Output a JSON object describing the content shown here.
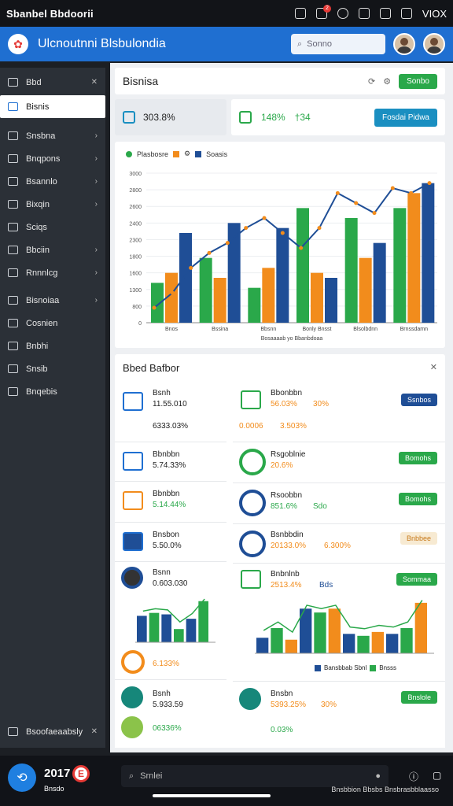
{
  "statusbar": {
    "title": "Sbanbel Bbdoorii",
    "right_text": "VIOX",
    "notification_count": "2"
  },
  "app": {
    "title": "Ulcnoutnni Blsbulondia",
    "search_placeholder": "Sonno"
  },
  "sidebar": {
    "items": [
      {
        "label": "Bbd",
        "icon": "dashboard-icon",
        "active": false,
        "chevron": false
      },
      {
        "label": "Bisnis",
        "icon": "display-icon",
        "active": true,
        "chevron": false
      },
      {
        "label": "Snsbna",
        "icon": "grid-icon",
        "active": false,
        "chevron": true
      },
      {
        "label": "Bnqpons",
        "icon": "box-icon",
        "active": false,
        "chevron": true
      },
      {
        "label": "Bsannlo",
        "icon": "calendar-icon",
        "active": false,
        "chevron": true
      },
      {
        "label": "Bixqin",
        "icon": "video-icon",
        "active": false,
        "chevron": true
      },
      {
        "label": "Sciqs",
        "icon": "lock-icon",
        "active": false,
        "chevron": false
      },
      {
        "label": "Bbciin",
        "icon": "heart-icon",
        "active": false,
        "chevron": true
      },
      {
        "label": "Rnnnlcg",
        "icon": "chart-icon",
        "active": false,
        "chevron": true
      },
      {
        "label": "Bisnoiaa",
        "icon": "grid-icon",
        "active": false,
        "chevron": true
      },
      {
        "label": "Cosnien",
        "icon": "settings-icon",
        "active": false,
        "chevron": false
      },
      {
        "label": "Bnbhi",
        "icon": "filter-icon",
        "active": false,
        "chevron": false
      },
      {
        "label": "Snsib",
        "icon": "sheet-icon",
        "active": false,
        "chevron": false
      },
      {
        "label": "Bnqebis",
        "icon": "info-icon",
        "active": false,
        "chevron": false
      }
    ],
    "footer": "Bsoofaeaabsly"
  },
  "header": {
    "title": "Bisnisa",
    "button": "Sonbo"
  },
  "stats": {
    "left_value": "303.8%",
    "right_value_a": "148%",
    "right_value_b": "†34",
    "right_button": "Fosdai Pidwa"
  },
  "chart_data": {
    "type": "bar",
    "legend": [
      "Plasbosre",
      "Soasis"
    ],
    "xlabel": "Bosaaaab yo Bbanbdoaa",
    "yticks": [
      "3000",
      "2800",
      "2600",
      "2400",
      "2300",
      "1800",
      "1600",
      "1300",
      "800",
      "0"
    ],
    "categories": [
      "Bnos",
      "Bssina",
      "Bbsnn",
      "Bonly Bnsst",
      "Blsolbdnn",
      "Brnssdamn"
    ],
    "series": [
      {
        "name": "Green",
        "color": "#2aa84a",
        "values": [
          800,
          1300,
          700,
          2300,
          2100,
          2300
        ]
      },
      {
        "name": "Orange",
        "color": "#f28c1c",
        "values": [
          1000,
          900,
          1100,
          1000,
          1300,
          2600
        ]
      },
      {
        "name": "Blue",
        "color": "#1f4e96",
        "values": [
          1800,
          2000,
          1900,
          900,
          1600,
          2800
        ]
      }
    ],
    "line": {
      "color": "#1f4e96",
      "values": [
        300,
        600,
        1100,
        1400,
        1600,
        1900,
        2100,
        1800,
        1500,
        1900,
        2600,
        2400,
        2200,
        2700,
        2600,
        2800
      ]
    }
  },
  "panel": {
    "title": "Bbed Bafbor",
    "left_rows": [
      {
        "name": "Bsnh",
        "value": "11.55.010"
      },
      {
        "name": "",
        "value": "6333.03%"
      },
      {
        "name": "Bbnbbn",
        "value": "5.74.33%"
      },
      {
        "name": "Bbnbbn",
        "value": "5.14.44%"
      },
      {
        "name": "Bnsbon",
        "value": "5.50.0%"
      },
      {
        "name": "Bsnn",
        "value": "0.603.030"
      },
      {
        "name": "",
        "value": "6.133%"
      },
      {
        "name": "Bsnh",
        "value": "5.933.59"
      },
      {
        "name": "",
        "value": "06336%"
      }
    ],
    "right_rows": [
      {
        "name": "Bbonbbn",
        "value": "56.03%",
        "extra": "30%",
        "pill": "Ssnbos"
      },
      {
        "name": "",
        "value": "0.0006",
        "extra": "3.503%",
        "pill": ""
      },
      {
        "name": "Rsgoblnie",
        "value": "20.6%",
        "extra": "",
        "pill": "Bomohs"
      },
      {
        "name": "Rsoobbn",
        "value": "851.6%",
        "extra": "Sdo",
        "pill": "Bomohs"
      },
      {
        "name": "Bsnbbdin",
        "value": "20133.0%",
        "extra": "6.300%",
        "pill": "Bnbbee"
      },
      {
        "name": "Bnbnlnb",
        "value": "2513.4%",
        "extra": "Bds",
        "pill": "Sommaa"
      },
      {
        "name": "Bnsbn",
        "value": "5393.25%",
        "extra": "30%",
        "pill": "Bnslole"
      },
      {
        "name": "",
        "value": "0.03%",
        "extra": "",
        "pill": ""
      }
    ],
    "right_legend": [
      "Bansbbab Sbnl",
      "Bnsss"
    ]
  },
  "bottom": {
    "time": "2017",
    "date": "Bnsdo",
    "icon_badge": "E",
    "search_placeholder": "Srnlei",
    "note": "Bnsbbion Bbsbs Bnsbrasbblaasso"
  }
}
